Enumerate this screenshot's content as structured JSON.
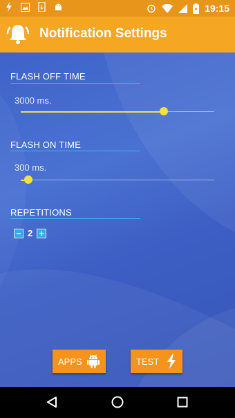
{
  "status_bar": {
    "time": "19:15",
    "left_icons": [
      "flash-icon",
      "image-icon",
      "sd-card-icon",
      "android-icon"
    ],
    "right_icons": [
      "alarm-icon",
      "wifi-icon",
      "signal-icon",
      "battery-charging-icon"
    ]
  },
  "app_bar": {
    "title": "Notification Settings",
    "icon": "bell-icon"
  },
  "flash_off": {
    "title": "FLASH OFF TIME",
    "value_label": "3000 ms.",
    "level": 0.74
  },
  "flash_on": {
    "title": "FLASH ON TIME",
    "value_label": "300 ms.",
    "level": 0.04
  },
  "repetitions": {
    "title": "REPETITIONS",
    "decrement": "−",
    "value": "2",
    "increment": "+"
  },
  "buttons": {
    "apps_label": "APPS",
    "apps_icon": "android-icon",
    "test_label": "TEST",
    "test_icon": "lightning-icon"
  },
  "nav_bar": {
    "icons": [
      "back-icon",
      "home-icon",
      "recents-icon"
    ]
  },
  "colors": {
    "status_bar": "#e8951c",
    "app_bar": "#f5a623",
    "background": "#3d5fc4",
    "slider_accent": "#f7df3e",
    "divider": "#3fb8e6",
    "button": "#f5931c"
  }
}
